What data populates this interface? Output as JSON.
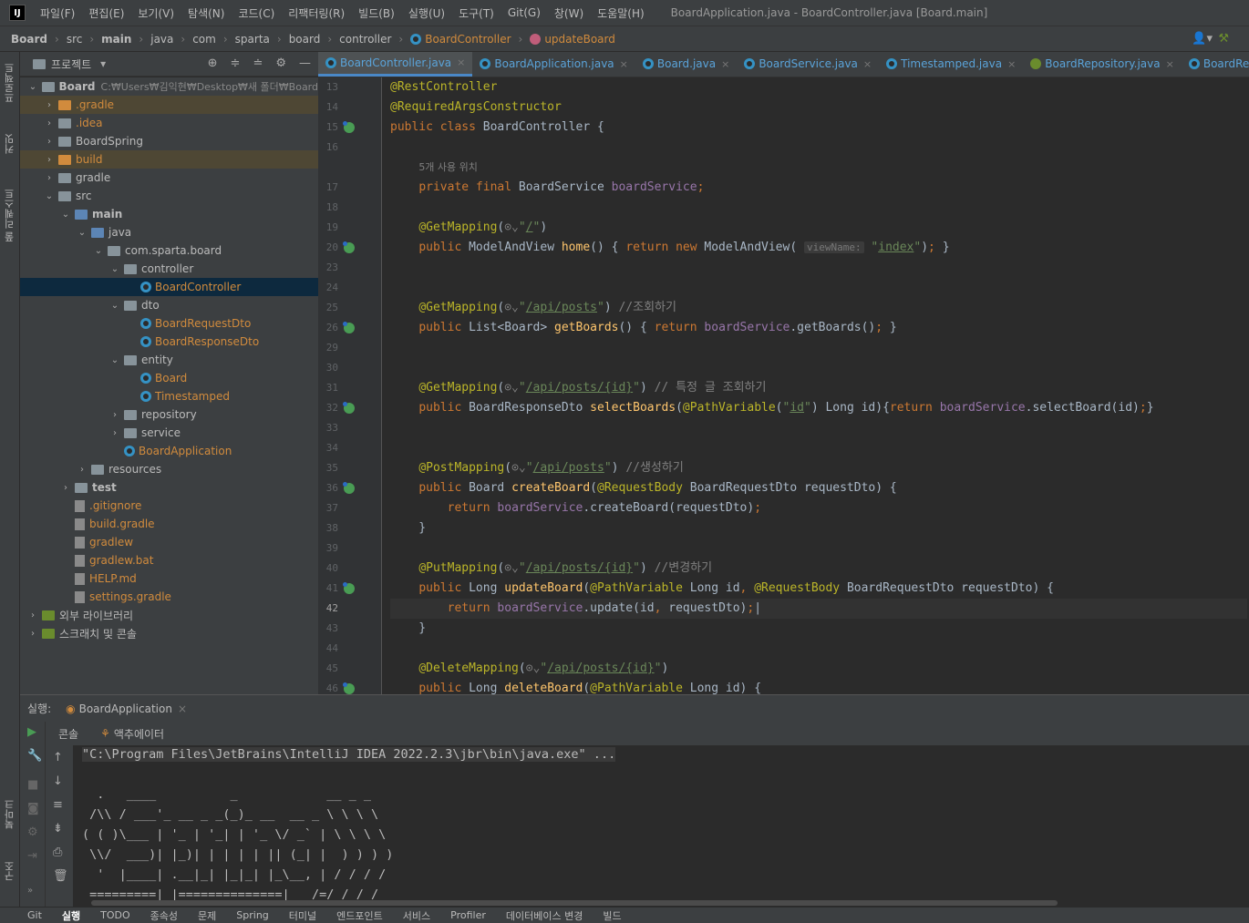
{
  "menu": {
    "logo": "IJ",
    "items": [
      "파일(F)",
      "편집(E)",
      "보기(V)",
      "탐색(N)",
      "코드(C)",
      "리팩터링(R)",
      "빌드(B)",
      "실행(U)",
      "도구(T)",
      "Git(G)",
      "창(W)",
      "도움말(H)"
    ],
    "window_title": "BoardApplication.java - BoardController.java [Board.main]"
  },
  "breadcrumb": {
    "items": [
      "Board",
      "src",
      "main",
      "java",
      "com",
      "sparta",
      "board",
      "controller",
      "BoardController",
      "updateBoard"
    ]
  },
  "side_strip": {
    "project": "프로젝트",
    "commit": "커밋",
    "pull_requests": "풀 리퀘스트",
    "bookmarks": "북마크",
    "structure": "구조"
  },
  "project_panel": {
    "title": "프로젝트",
    "tree": [
      {
        "label": "Board",
        "suffix": "C:₩Users₩김익현₩Desktop₩새 폴더₩Board",
        "depth": 0,
        "arrow": "down",
        "type": "folder",
        "bold": true
      },
      {
        "label": ".gradle",
        "depth": 1,
        "arrow": "right",
        "type": "folder-orange",
        "color": "#d18b3d"
      },
      {
        "label": ".idea",
        "depth": 1,
        "arrow": "right",
        "type": "folder",
        "color": "#d18b3d"
      },
      {
        "label": "BoardSpring",
        "depth": 1,
        "arrow": "right",
        "type": "folder"
      },
      {
        "label": "build",
        "depth": 1,
        "arrow": "right",
        "type": "folder-orange",
        "color": "#d18b3d"
      },
      {
        "label": "gradle",
        "depth": 1,
        "arrow": "right",
        "type": "folder"
      },
      {
        "label": "src",
        "depth": 1,
        "arrow": "down",
        "type": "folder"
      },
      {
        "label": "main",
        "depth": 2,
        "arrow": "down",
        "type": "folder-blue",
        "bold": true
      },
      {
        "label": "java",
        "depth": 3,
        "arrow": "down",
        "type": "folder-blue"
      },
      {
        "label": "com.sparta.board",
        "depth": 4,
        "arrow": "down",
        "type": "folder"
      },
      {
        "label": "controller",
        "depth": 5,
        "arrow": "down",
        "type": "folder"
      },
      {
        "label": "BoardController",
        "depth": 6,
        "arrow": "",
        "type": "class",
        "color": "#d18b3d"
      },
      {
        "label": "dto",
        "depth": 5,
        "arrow": "down",
        "type": "folder"
      },
      {
        "label": "BoardRequestDto",
        "depth": 6,
        "arrow": "",
        "type": "class",
        "color": "#d18b3d"
      },
      {
        "label": "BoardResponseDto",
        "depth": 6,
        "arrow": "",
        "type": "class",
        "color": "#d18b3d"
      },
      {
        "label": "entity",
        "depth": 5,
        "arrow": "down",
        "type": "folder"
      },
      {
        "label": "Board",
        "depth": 6,
        "arrow": "",
        "type": "class",
        "color": "#d18b3d"
      },
      {
        "label": "Timestamped",
        "depth": 6,
        "arrow": "",
        "type": "class",
        "color": "#d18b3d"
      },
      {
        "label": "repository",
        "depth": 5,
        "arrow": "right",
        "type": "folder"
      },
      {
        "label": "service",
        "depth": 5,
        "arrow": "right",
        "type": "folder"
      },
      {
        "label": "BoardApplication",
        "depth": 5,
        "arrow": "",
        "type": "class",
        "color": "#d18b3d"
      },
      {
        "label": "resources",
        "depth": 3,
        "arrow": "right",
        "type": "folder"
      },
      {
        "label": "test",
        "depth": 2,
        "arrow": "right",
        "type": "folder",
        "bold": true
      },
      {
        "label": ".gitignore",
        "depth": 2,
        "arrow": "",
        "type": "file",
        "color": "#d18b3d"
      },
      {
        "label": "build.gradle",
        "depth": 2,
        "arrow": "",
        "type": "file",
        "color": "#d18b3d"
      },
      {
        "label": "gradlew",
        "depth": 2,
        "arrow": "",
        "type": "file",
        "color": "#d18b3d"
      },
      {
        "label": "gradlew.bat",
        "depth": 2,
        "arrow": "",
        "type": "file",
        "color": "#d18b3d"
      },
      {
        "label": "HELP.md",
        "depth": 2,
        "arrow": "",
        "type": "file",
        "color": "#d18b3d"
      },
      {
        "label": "settings.gradle",
        "depth": 2,
        "arrow": "",
        "type": "file",
        "color": "#d18b3d"
      },
      {
        "label": "외부 라이브러리",
        "depth": 0,
        "arrow": "right",
        "type": "lib"
      },
      {
        "label": "스크래치 및 콘솔",
        "depth": 0,
        "arrow": "right",
        "type": "lib"
      }
    ]
  },
  "tabs": [
    {
      "label": "BoardController.java",
      "icon": "class",
      "active": true
    },
    {
      "label": "BoardApplication.java",
      "icon": "class"
    },
    {
      "label": "Board.java",
      "icon": "class"
    },
    {
      "label": "BoardService.java",
      "icon": "class"
    },
    {
      "label": "Timestamped.java",
      "icon": "class"
    },
    {
      "label": "BoardRepository.java",
      "icon": "interface"
    },
    {
      "label": "BoardRequestDto.java",
      "icon": "class"
    }
  ],
  "editor": {
    "lines": [
      {
        "n": "13",
        "html": "<span class='an'>@RestController</span>"
      },
      {
        "n": "14",
        "html": "<span class='an'>@RequiredArgsConstructor</span>"
      },
      {
        "n": "15",
        "gi": true,
        "html": "<span class='kw'>public class </span>BoardController {"
      },
      {
        "n": "16",
        "html": ""
      },
      {
        "n": "",
        "html": "    <span class='cm' style='font-family:\"DejaVu Sans\",sans-serif;font-size:11px'>5개 사용 위치</span>"
      },
      {
        "n": "17",
        "html": "    <span class='kw'>private final </span>BoardService <span class='fld'>boardService</span><span class='kw'>;</span>"
      },
      {
        "n": "18",
        "html": ""
      },
      {
        "n": "19",
        "html": "    <span class='an'>@GetMapping</span>(<span class='cm'>⊙⌄</span><span class='st'>\"<span class='url'>/</span>\"</span>)"
      },
      {
        "n": "20",
        "gi": true,
        "html": "    <span class='kw'>public </span>ModelAndView <span class='fn'>home</span>() { <span class='kw'>return new </span>ModelAndView( <span class='hint'>viewName:</span> <span class='st'>\"<span class='url'>index</span>\"</span>)<span class='kw'>;</span> }"
      },
      {
        "n": "23",
        "html": ""
      },
      {
        "n": "24",
        "html": ""
      },
      {
        "n": "25",
        "html": "    <span class='an'>@GetMapping</span>(<span class='cm'>⊙⌄</span><span class='st'>\"<span class='url'>/api/posts</span>\"</span>) <span class='cm'>//조회하기</span>"
      },
      {
        "n": "26",
        "gi": true,
        "html": "    <span class='kw'>public </span>List&lt;Board&gt; <span class='fn'>getBoards</span>() { <span class='kw'>return </span><span class='fld'>boardService</span>.getBoards()<span class='kw'>;</span> }"
      },
      {
        "n": "29",
        "html": ""
      },
      {
        "n": "30",
        "html": ""
      },
      {
        "n": "31",
        "html": "    <span class='an'>@GetMapping</span>(<span class='cm'>⊙⌄</span><span class='st'>\"<span class='url'>/api/posts/{id}</span>\"</span>) <span class='cm'>// 특정 글 조회하기</span>"
      },
      {
        "n": "32",
        "gi": true,
        "html": "    <span class='kw'>public </span>BoardResponseDto <span class='fn'>selectBoards</span>(<span class='an'>@PathVariable</span>(<span class='st'>\"<span class='url'>id</span>\"</span>) Long id){<span class='kw'>return </span><span class='fld'>boardService</span>.selectBoard(id)<span class='kw'>;</span>}"
      },
      {
        "n": "33",
        "html": ""
      },
      {
        "n": "34",
        "html": ""
      },
      {
        "n": "35",
        "html": "    <span class='an'>@PostMapping</span>(<span class='cm'>⊙⌄</span><span class='st'>\"<span class='url'>/api/posts</span>\"</span>) <span class='cm'>//생성하기</span>"
      },
      {
        "n": "36",
        "gi": true,
        "html": "    <span class='kw'>public </span>Board <span class='fn'>createBoard</span>(<span class='an'>@RequestBody </span>BoardRequestDto requestDto) {"
      },
      {
        "n": "37",
        "html": "        <span class='kw'>return </span><span class='fld'>boardService</span>.createBoard(requestDto)<span class='kw'>;</span>"
      },
      {
        "n": "38",
        "html": "    }"
      },
      {
        "n": "39",
        "html": ""
      },
      {
        "n": "40",
        "html": "    <span class='an'>@PutMapping</span>(<span class='cm'>⊙⌄</span><span class='st'>\"<span class='url'>/api/posts/{id}</span>\"</span>) <span class='cm'>//변경하기</span>"
      },
      {
        "n": "41",
        "gi": true,
        "html": "    <span class='kw'>public </span>Long <span class='fn'>updateBoard</span>(<span class='an'>@PathVariable </span>Long id<span class='kw'>, </span><span class='an'>@RequestBody </span>BoardRequestDto requestDto) {"
      },
      {
        "n": "42",
        "cur": true,
        "html": "        <span class='kw'>return </span><span class='fld'>boardService</span>.update(id<span class='kw'>, </span>requestDto)<span class='kw'>;</span>|"
      },
      {
        "n": "43",
        "html": "    }"
      },
      {
        "n": "44",
        "html": ""
      },
      {
        "n": "45",
        "html": "    <span class='an'>@DeleteMapping</span>(<span class='cm'>⊙⌄</span><span class='st'>\"<span class='url'>/api/posts/{id}</span>\"</span>)"
      },
      {
        "n": "46",
        "gi": true,
        "html": "    <span class='kw'>public </span>Long <span class='fn'>deleteBoard</span>(<span class='an'>@PathVariable </span>Long id) {"
      }
    ]
  },
  "run_panel": {
    "label": "실행:",
    "tab": "BoardApplication",
    "subtabs": [
      "콘솔",
      "액추에이터"
    ],
    "console_lines": [
      "\"C:\\Program Files\\JetBrains\\IntelliJ IDEA 2022.2.3\\jbr\\bin\\java.exe\" ...",
      "",
      "  .   ____          _            __ _ _",
      " /\\\\ / ___'_ __ _ _(_)_ __  __ _ \\ \\ \\ \\",
      "( ( )\\___ | '_ | '_| | '_ \\/ _` | \\ \\ \\ \\",
      " \\\\/  ___)| |_)| | | | | || (_| |  ) ) ) )",
      "  '  |____| .__|_| |_|_| |_\\__, | / / / /",
      " =========|_|==============|___/=/_/_/_/"
    ]
  },
  "statusbar": {
    "items": [
      "Git",
      "실행",
      "TODO",
      "종속성",
      "문제",
      "Spring",
      "터미널",
      "엔드포인트",
      "서비스",
      "Profiler",
      "데이터베이스 변경",
      "빌드"
    ]
  }
}
